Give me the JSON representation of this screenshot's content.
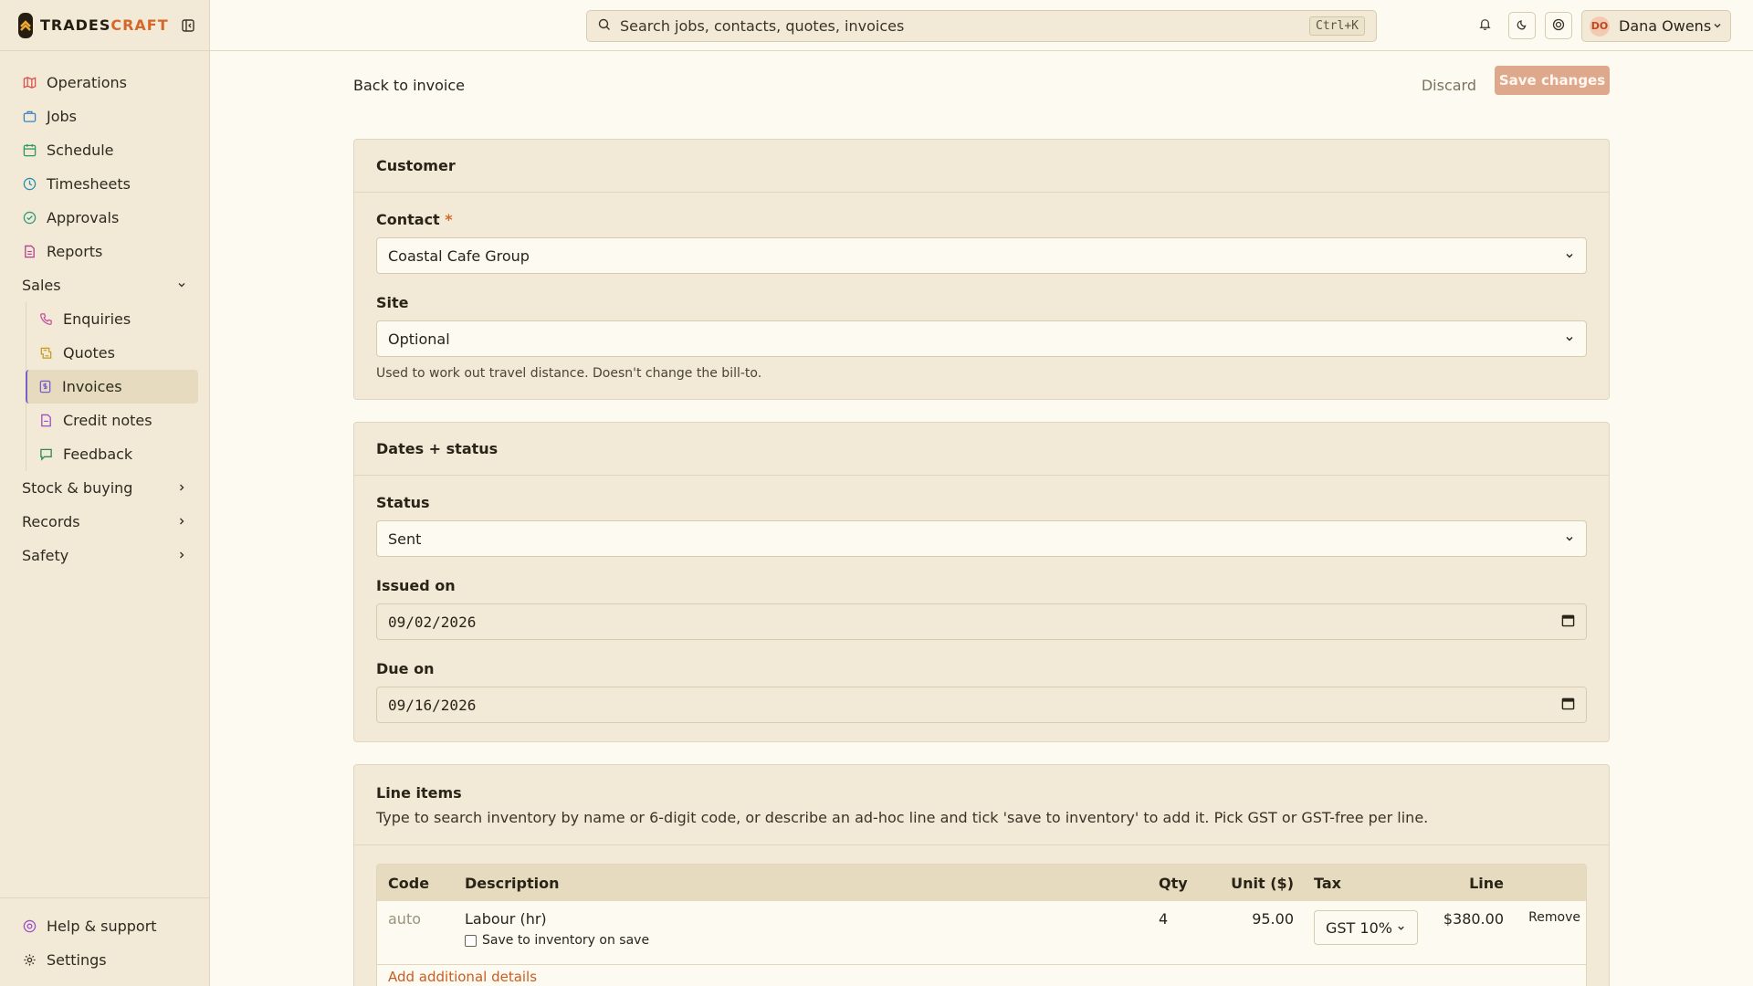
{
  "brand": {
    "name_part1": "TRADES",
    "name_part2": "CRAFT"
  },
  "sidebar": {
    "items": [
      {
        "label": "Operations",
        "icon": "map-icon",
        "color": "#d9534f"
      },
      {
        "label": "Jobs",
        "icon": "briefcase-icon",
        "color": "#3b82c4"
      },
      {
        "label": "Schedule",
        "icon": "calendar-icon",
        "color": "#2e9b58"
      },
      {
        "label": "Timesheets",
        "icon": "clock-icon",
        "color": "#2b8fb0"
      },
      {
        "label": "Approvals",
        "icon": "check-circle-icon",
        "color": "#2e9b78"
      },
      {
        "label": "Reports",
        "icon": "report-icon",
        "color": "#b04090"
      }
    ],
    "sales_group": "Sales",
    "sales_items": [
      {
        "label": "Enquiries",
        "icon": "phone-icon",
        "color": "#c44a9a"
      },
      {
        "label": "Quotes",
        "icon": "quote-icon",
        "color": "#c49a1a"
      },
      {
        "label": "Invoices",
        "icon": "invoice-icon",
        "color": "#7a5ec9"
      },
      {
        "label": "Credit notes",
        "icon": "credit-note-icon",
        "color": "#9a4fc4"
      },
      {
        "label": "Feedback",
        "icon": "message-icon",
        "color": "#2e8b57"
      }
    ],
    "groups": [
      "Stock & buying",
      "Records",
      "Safety"
    ],
    "footer": [
      {
        "label": "Help & support",
        "icon": "help-icon",
        "color": "#9a4fc4"
      },
      {
        "label": "Settings",
        "icon": "gear-icon",
        "color": "#3b3426"
      }
    ]
  },
  "topbar": {
    "search_placeholder": "Search jobs, contacts, quotes, invoices",
    "shortcut": "Ctrl+K",
    "user_initials": "DO",
    "user_name": "Dana Owens"
  },
  "toolbar": {
    "back_label": "Back to invoice",
    "discard_label": "Discard",
    "save_label": "Save changes"
  },
  "customer": {
    "title": "Customer",
    "contact_label": "Contact",
    "contact_required": "*",
    "contact_value": "Coastal Cafe Group",
    "site_label": "Site",
    "site_value": "Optional",
    "site_help": "Used to work out travel distance. Doesn't change the bill-to."
  },
  "dates": {
    "title": "Dates + status",
    "status_label": "Status",
    "status_value": "Sent",
    "issued_label": "Issued on",
    "issued_value": "09/02/2026",
    "due_label": "Due on",
    "due_value": "09/16/2026"
  },
  "line_items": {
    "title": "Line items",
    "subtitle": "Type to search inventory by name or 6-digit code, or describe an ad-hoc line and tick 'save to inventory' to add it. Pick GST or GST-free per line.",
    "columns": [
      "Code",
      "Description",
      "Qty",
      "Unit ($)",
      "Tax",
      "Line"
    ],
    "rows": [
      {
        "code": "auto",
        "description": "Labour (hr)",
        "save_to_inventory": "Save to inventory on save",
        "qty": "4",
        "unit": "95.00",
        "tax": "GST 10%",
        "line": "$380.00",
        "remove": "Remove"
      }
    ],
    "add_details": "Add additional details"
  }
}
